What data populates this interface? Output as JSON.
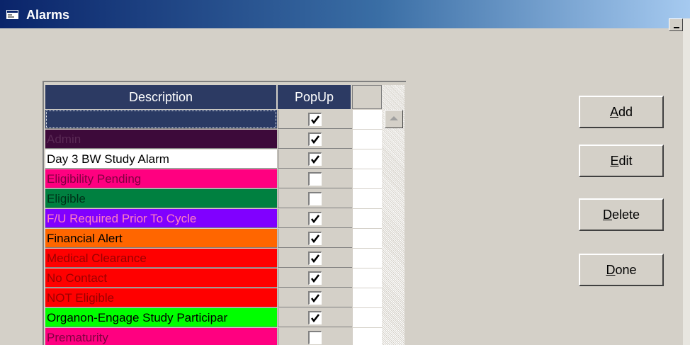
{
  "window": {
    "title": "Alarms",
    "icon": "window-app-icon"
  },
  "grid": {
    "columns": {
      "description": "Description",
      "popup": "PopUp"
    },
    "rows": [
      {
        "description": "",
        "popup": true,
        "bg": "#2a3a64",
        "fg": "#ffffff",
        "selected": true
      },
      {
        "description": "Admin",
        "popup": true,
        "bg": "#3d0a3a",
        "fg": "#5a2a55"
      },
      {
        "description": "Day 3 BW Study Alarm",
        "popup": true,
        "bg": "#ffffff",
        "fg": "#000000"
      },
      {
        "description": "Eligibility Pending",
        "popup": false,
        "bg": "#ff0080",
        "fg": "#800040"
      },
      {
        "description": "Eligible",
        "popup": false,
        "bg": "#008040",
        "fg": "#003018"
      },
      {
        "description": "F/U Required Prior To Cycle",
        "popup": true,
        "bg": "#8000ff",
        "fg": "#ff80c0"
      },
      {
        "description": "Financial Alert",
        "popup": true,
        "bg": "#ff6600",
        "fg": "#000000"
      },
      {
        "description": "Medical Clearance",
        "popup": true,
        "bg": "#ff0000",
        "fg": "#990000"
      },
      {
        "description": "No Contact",
        "popup": true,
        "bg": "#ff0000",
        "fg": "#990000"
      },
      {
        "description": "NOT Eligible",
        "popup": true,
        "bg": "#ff0000",
        "fg": "#990000"
      },
      {
        "description": "Organon-Engage Study Participar",
        "popup": true,
        "bg": "#00ff00",
        "fg": "#000000"
      },
      {
        "description": "Prematurity",
        "popup": false,
        "bg": "#ff0080",
        "fg": "#800040"
      }
    ]
  },
  "buttons": {
    "add": {
      "mnemonic": "A",
      "rest": "dd"
    },
    "edit": {
      "mnemonic": "E",
      "rest": "dit"
    },
    "delete": {
      "mnemonic": "D",
      "rest": "elete"
    },
    "done": {
      "mnemonic": "D",
      "rest": "one"
    }
  }
}
